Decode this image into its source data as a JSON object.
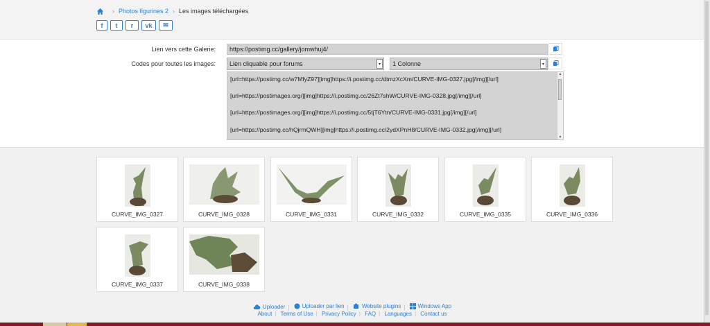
{
  "breadcrumb": {
    "home": "home-icon",
    "album": "Photos figurines 2",
    "current": "Les images téléchargées"
  },
  "share": [
    {
      "icon": "facebook-icon",
      "glyph": "f"
    },
    {
      "icon": "twitter-icon",
      "glyph": "t"
    },
    {
      "icon": "reddit-icon",
      "glyph": "r"
    },
    {
      "icon": "vk-icon",
      "glyph": "vk"
    },
    {
      "icon": "email-icon",
      "glyph": "✉"
    }
  ],
  "gallery_link": {
    "label": "Lien vers cette Galerie:",
    "value": "https://postimg.cc/gallery/jomwhuj4/"
  },
  "codes": {
    "label": "Codes pour toutes les images:",
    "format_selected": "Lien cliquable pour forums",
    "columns_selected": "1 Colonne",
    "lines": [
      "[url=https://postimg.cc/w7MfyZ97][img]https://i.postimg.cc/dtmzXcXm/CURVE-IMG-0327.jpg[/img][/url]",
      "[url=https://postimages.org/][img]https://i.postimg.cc/26Zt7shW/CURVE-IMG-0328.jpg[/img][/url]",
      "[url=https://postimages.org/][img]https://i.postimg.cc/5tjT6Ytn/CURVE-IMG-0331.jpg[/img][/url]",
      "[url=https://postimg.cc/hQjrmQWH][img]https://i.postimg.cc/2ydXPnH8/CURVE-IMG-0332.jpg[/img][/url]"
    ]
  },
  "images": [
    {
      "title": "CURVE_IMG_0327",
      "orientation": "portrait"
    },
    {
      "title": "CURVE_IMG_0328",
      "orientation": "landscape"
    },
    {
      "title": "CURVE_IMG_0331",
      "orientation": "landscape"
    },
    {
      "title": "CURVE_IMG_0332",
      "orientation": "portrait"
    },
    {
      "title": "CURVE_IMG_0335",
      "orientation": "portrait"
    },
    {
      "title": "CURVE_IMG_0336",
      "orientation": "portrait"
    },
    {
      "title": "CURVE_IMG_0337",
      "orientation": "portrait"
    },
    {
      "title": "CURVE_IMG_0338",
      "orientation": "landscape"
    }
  ],
  "footer": {
    "row1": [
      {
        "label": "Uploader",
        "icon": "cloud-upload-icon"
      },
      {
        "label": "Uploader par lien",
        "icon": "globe-icon"
      },
      {
        "label": "Website plugins",
        "icon": "puzzle-icon"
      },
      {
        "label": "Windows App",
        "icon": "windows-icon"
      }
    ],
    "row2": [
      "About",
      "Terms of Use",
      "Privacy Policy",
      "FAQ",
      "Languages",
      "Contact us"
    ]
  },
  "colors": {
    "link": "#2f7fd2",
    "field_bg": "#d3d3d3",
    "card_border": "#dddddd"
  }
}
